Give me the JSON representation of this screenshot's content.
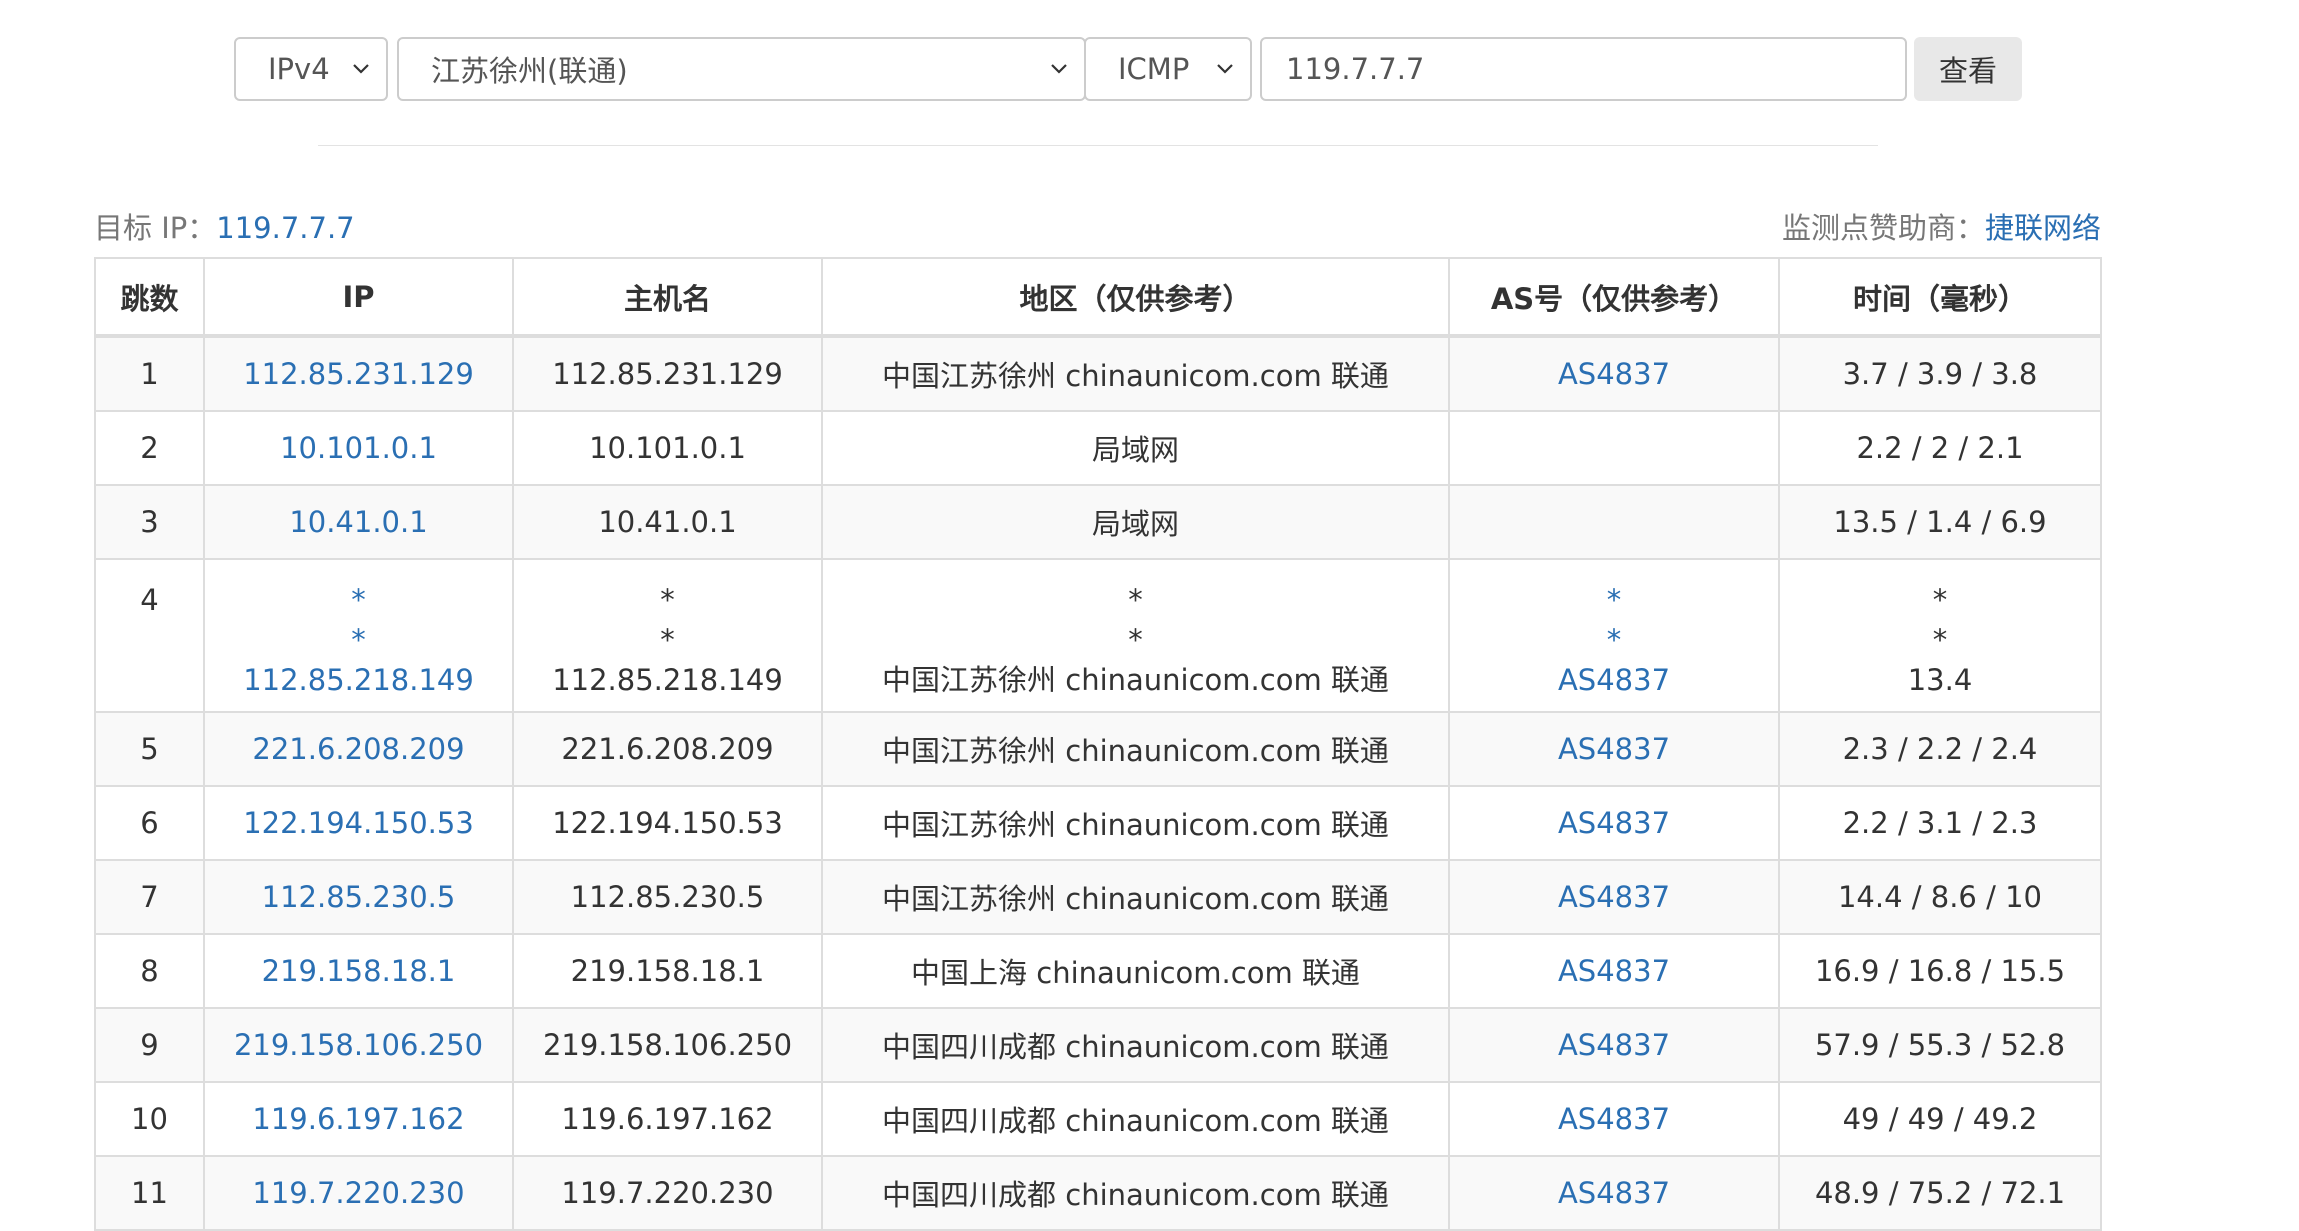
{
  "toolbar": {
    "ip_version": "IPv4",
    "node": "江苏徐州(联通)",
    "protocol": "ICMP",
    "target": "119.7.7.7",
    "query_label": "查看"
  },
  "meta": {
    "target_label": "目标 IP：",
    "target_value": "119.7.7.7",
    "sponsor_label": "监测点赞助商：",
    "sponsor_value": "捷联网络"
  },
  "table": {
    "headers": [
      "跳数",
      "IP",
      "主机名",
      "地区（仅供参考）",
      "AS号（仅供参考）",
      "时间（毫秒）"
    ],
    "rows": [
      {
        "hop": "1",
        "ip": "112.85.231.129",
        "host": "112.85.231.129",
        "region": "中国江苏徐州 chinaunicom.com 联通",
        "asn": "AS4837",
        "time": "3.7 / 3.9 / 3.8"
      },
      {
        "hop": "2",
        "ip": "10.101.0.1",
        "host": "10.101.0.1",
        "region": "局域网",
        "asn": "",
        "time": "2.2 / 2 / 2.1"
      },
      {
        "hop": "3",
        "ip": "10.41.0.1",
        "host": "10.41.0.1",
        "region": "局域网",
        "asn": "",
        "time": "13.5 / 1.4 / 6.9"
      },
      {
        "hop": "4",
        "ip": "112.85.218.149",
        "host": "112.85.218.149",
        "region": "中国江苏徐州 chinaunicom.com 联通",
        "asn": "AS4837",
        "time": "13.4",
        "star": "*"
      },
      {
        "hop": "5",
        "ip": "221.6.208.209",
        "host": "221.6.208.209",
        "region": "中国江苏徐州 chinaunicom.com 联通",
        "asn": "AS4837",
        "time": "2.3 / 2.2 / 2.4"
      },
      {
        "hop": "6",
        "ip": "122.194.150.53",
        "host": "122.194.150.53",
        "region": "中国江苏徐州 chinaunicom.com 联通",
        "asn": "AS4837",
        "time": "2.2 / 3.1 / 2.3"
      },
      {
        "hop": "7",
        "ip": "112.85.230.5",
        "host": "112.85.230.5",
        "region": "中国江苏徐州 chinaunicom.com 联通",
        "asn": "AS4837",
        "time": "14.4 / 8.6 / 10"
      },
      {
        "hop": "8",
        "ip": "219.158.18.1",
        "host": "219.158.18.1",
        "region": "中国上海 chinaunicom.com 联通",
        "asn": "AS4837",
        "time": "16.9 / 16.8 / 15.5"
      },
      {
        "hop": "9",
        "ip": "219.158.106.250",
        "host": "219.158.106.250",
        "region": "中国四川成都 chinaunicom.com 联通",
        "asn": "AS4837",
        "time": "57.9 / 55.3 / 52.8"
      },
      {
        "hop": "10",
        "ip": "119.6.197.162",
        "host": "119.6.197.162",
        "region": "中国四川成都 chinaunicom.com 联通",
        "asn": "AS4837",
        "time": "49 / 49 / 49.2"
      },
      {
        "hop": "11",
        "ip": "119.7.220.230",
        "host": "119.7.220.230",
        "region": "中国四川成都 chinaunicom.com 联通",
        "asn": "AS4837",
        "time": "48.9 / 75.2 / 72.1"
      }
    ]
  },
  "colors": {
    "link": "#2a6fb3",
    "border": "#dddddd",
    "stripe": "#f9f9f9",
    "button": "#e8e8e8"
  },
  "icons": {
    "dropdown": "chevron-down-icon"
  }
}
